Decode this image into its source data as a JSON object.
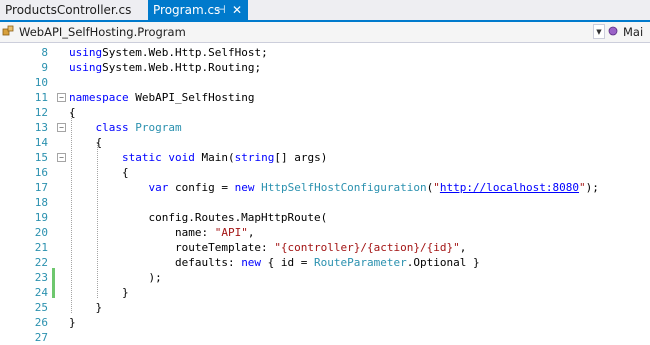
{
  "tabs": [
    {
      "label": "ProductsController.cs",
      "active": false
    },
    {
      "label": "Program.cs",
      "active": true,
      "pin": "⊣",
      "close": "✕"
    }
  ],
  "navbar": {
    "left_label": "WebAPI_SelfHosting.Program",
    "dropdown_glyph": "▼",
    "right_label": "Mai"
  },
  "code": {
    "lines": [
      {
        "num": "8",
        "fold": null,
        "tokens": [
          [
            "kw",
            "using"
          ],
          [
            "",
            "System.Web.Http.SelfHost;"
          ]
        ]
      },
      {
        "num": "9",
        "fold": null,
        "tokens": [
          [
            "kw",
            "using"
          ],
          [
            "",
            "System.Web.Http.Routing;"
          ]
        ]
      },
      {
        "num": "10",
        "fold": null,
        "tokens": []
      },
      {
        "num": "11",
        "fold": "−",
        "tokens": [
          [
            "kw",
            "namespace"
          ],
          [
            "",
            " WebAPI_SelfHosting"
          ]
        ]
      },
      {
        "num": "12",
        "fold": null,
        "tokens": [
          [
            "",
            "{"
          ]
        ]
      },
      {
        "num": "13",
        "fold": "−",
        "tokens": [
          [
            "",
            "    "
          ],
          [
            "kw",
            "class"
          ],
          [
            "",
            " "
          ],
          [
            "ty",
            "Program"
          ]
        ]
      },
      {
        "num": "14",
        "fold": null,
        "tokens": [
          [
            "",
            "    {"
          ]
        ]
      },
      {
        "num": "15",
        "fold": "−",
        "tokens": [
          [
            "",
            "        "
          ],
          [
            "kw",
            "static"
          ],
          [
            "",
            " "
          ],
          [
            "kw",
            "void"
          ],
          [
            "",
            " Main("
          ],
          [
            "kw",
            "string"
          ],
          [
            "",
            "[] args)"
          ]
        ]
      },
      {
        "num": "16",
        "fold": null,
        "tokens": [
          [
            "",
            "        {"
          ]
        ]
      },
      {
        "num": "17",
        "fold": null,
        "tokens": [
          [
            "",
            "            "
          ],
          [
            "kw",
            "var"
          ],
          [
            "",
            " config = "
          ],
          [
            "kw",
            "new"
          ],
          [
            "",
            " "
          ],
          [
            "ty",
            "HttpSelfHostConfiguration"
          ],
          [
            "",
            "("
          ],
          [
            "st",
            "\""
          ],
          [
            "url",
            "http://localhost:8080"
          ],
          [
            "st",
            "\""
          ],
          [
            "",
            ");"
          ]
        ]
      },
      {
        "num": "18",
        "fold": null,
        "tokens": []
      },
      {
        "num": "19",
        "fold": null,
        "tokens": [
          [
            "",
            "            config.Routes.MapHttpRoute("
          ]
        ]
      },
      {
        "num": "20",
        "fold": null,
        "tokens": [
          [
            "",
            "                name: "
          ],
          [
            "st",
            "\"API\""
          ],
          [
            "",
            ","
          ]
        ]
      },
      {
        "num": "21",
        "fold": null,
        "tokens": [
          [
            "",
            "                routeTemplate: "
          ],
          [
            "st",
            "\"{controller}/{action}/{id}\""
          ],
          [
            "",
            ","
          ]
        ]
      },
      {
        "num": "22",
        "fold": null,
        "tokens": [
          [
            "",
            "                defaults: "
          ],
          [
            "kw",
            "new"
          ],
          [
            "",
            " { id = "
          ],
          [
            "ty",
            "RouteParameter"
          ],
          [
            "",
            ".Optional }"
          ]
        ]
      },
      {
        "num": "23",
        "fold": null,
        "tokens": [
          [
            "",
            "            );"
          ]
        ]
      },
      {
        "num": "24",
        "fold": null,
        "tokens": [
          [
            "",
            "        }"
          ]
        ]
      },
      {
        "num": "25",
        "fold": null,
        "tokens": [
          [
            "",
            "    }"
          ]
        ]
      },
      {
        "num": "26",
        "fold": null,
        "tokens": [
          [
            "",
            "}"
          ]
        ]
      },
      {
        "num": "27",
        "fold": null,
        "tokens": []
      }
    ]
  },
  "colors": {
    "tab_active_bg": "#007acc",
    "keyword": "#0000ff",
    "type": "#2b91af",
    "string": "#a31515",
    "line_number": "#2b91af",
    "change_bar": "#6ec76e"
  },
  "icons": [
    "csharp-class-icon",
    "method-icon",
    "pin-icon",
    "close-icon",
    "chevron-down-icon"
  ]
}
